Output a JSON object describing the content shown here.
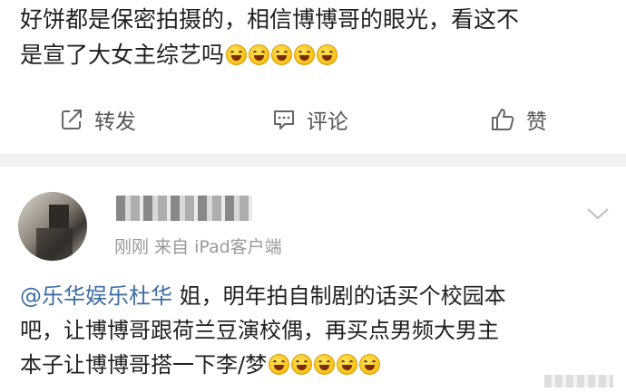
{
  "post": {
    "line1": "好饼都是保密拍摄的，相信博博哥的眼光，看这不",
    "line2": "是宣了大女主综艺吗"
  },
  "actions": {
    "repost_label": "转发",
    "comment_label": "评论",
    "like_label": "赞"
  },
  "comment": {
    "meta": "刚刚  来自 iPad客户端",
    "mention": "@乐华娱乐杜华",
    "text_after_mention": " 姐，明年拍自制剧的话买个校园本",
    "line2": "吧，让博博哥跟荷兰豆演校偶，再买点男频大男主",
    "line3": "本子让博博哥搭一下李/梦"
  },
  "icons": {
    "repost": "repost-icon",
    "comment": "comment-icon",
    "like": "thumbs-up-icon",
    "menu": "chevron-down-icon",
    "emoji": "grinning-face-emoji"
  },
  "colors": {
    "mention": "#3f6da1",
    "meta": "#9a9a9a",
    "divider": "#f2f2f2"
  }
}
